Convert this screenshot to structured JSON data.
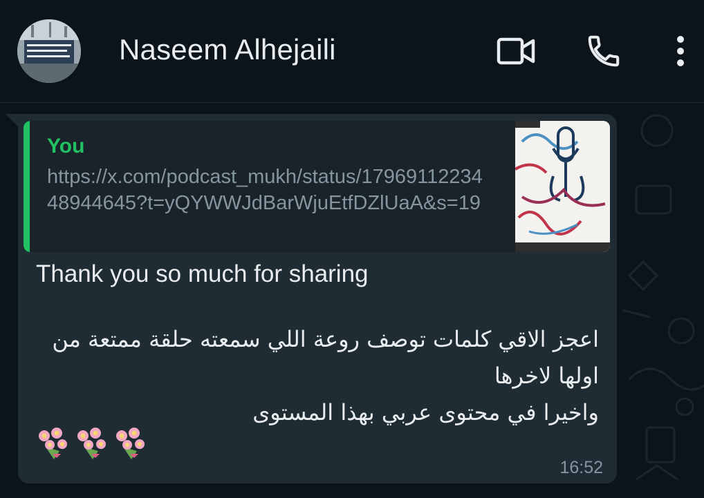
{
  "header": {
    "contact_name": "Naseem Alhejaili",
    "icons": [
      "video-call-icon",
      "voice-call-icon",
      "more-options-icon"
    ]
  },
  "message": {
    "quote": {
      "author": "You",
      "text": "https://x.com/podcast_mukh/status/1796911223448944645?t=yQYWWJdBarWjuEtfDZlUaA&s=19"
    },
    "text_en": "Thank you so much for sharing",
    "text_ar_lines": [
      "اعجز الاقي كلمات توصف روعة اللي سمعته حلقة ممتعة من",
      "اولها لاخرها",
      "واخيرا في محتوى عربي بهذا المستوى"
    ],
    "emojis": [
      "💐",
      "💐",
      "💐"
    ],
    "time": "16:52"
  },
  "colors": {
    "background": "#0b141a",
    "bubble": "#1f2c34",
    "accent": "#21c063",
    "muted_text": "#8696a0",
    "text": "#e9edef"
  }
}
